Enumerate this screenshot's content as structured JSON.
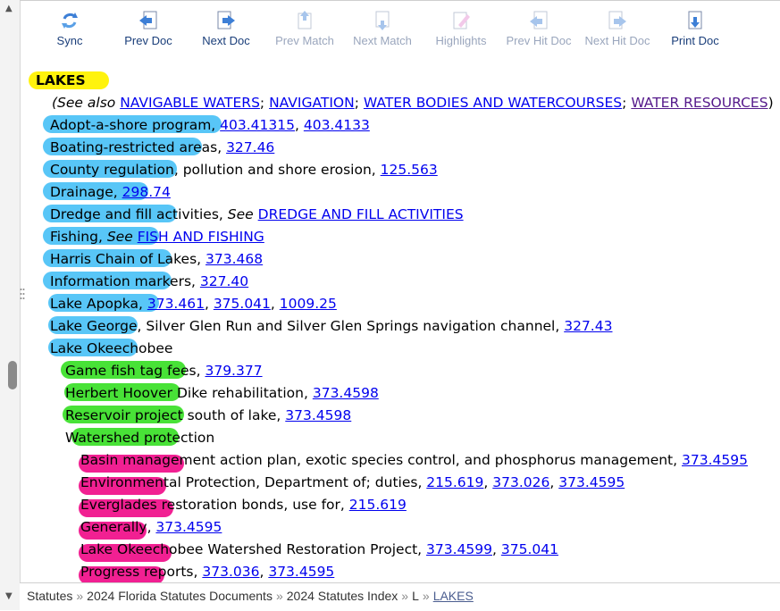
{
  "toolbar": {
    "sync": "Sync",
    "prev_doc": "Prev Doc",
    "next_doc": "Next Doc",
    "prev_match": "Prev Match",
    "next_match": "Next Match",
    "highlights": "Highlights",
    "prev_hit_doc": "Prev Hit Doc",
    "next_hit_doc": "Next Hit Doc",
    "print_doc": "Print Doc"
  },
  "index": {
    "heading": "LAKES",
    "see_also": {
      "prefix": "(See also",
      "links": [
        "NAVIGABLE WATERS",
        "NAVIGATION",
        "WATER BODIES AND WATERCOURSES",
        "WATER RESOURCES"
      ],
      "suffix": ")"
    },
    "entries": [
      {
        "text": "Adopt-a-shore program, ",
        "links": [
          "403.41315",
          "403.4133"
        ]
      },
      {
        "text": "Boating-restricted areas, ",
        "links": [
          "327.46"
        ]
      },
      {
        "text": "County regulation, pollution and shore erosion, ",
        "links": [
          "125.563"
        ]
      },
      {
        "text": "Drainage, ",
        "links": [
          "298.74"
        ]
      },
      {
        "text": "Dredge and fill activities, ",
        "see": "See",
        "links": [
          "DREDGE AND FILL ACTIVITIES"
        ]
      },
      {
        "text": "Fishing, ",
        "see": "See",
        "links": [
          "FISH AND FISHING"
        ]
      },
      {
        "text": "Harris Chain of Lakes, ",
        "links": [
          "373.468"
        ]
      },
      {
        "text": "Information markers, ",
        "links": [
          "327.40"
        ]
      },
      {
        "text": "Lake Apopka, ",
        "links": [
          "373.461",
          "375.041",
          "1009.25"
        ]
      },
      {
        "text": "Lake George, Silver Glen Run and Silver Glen Springs navigation channel, ",
        "links": [
          "327.43"
        ]
      },
      {
        "text": "Lake Okeechobee"
      }
    ],
    "okeechobee_sub": [
      {
        "text": "Game fish tag fees, ",
        "links": [
          "379.377"
        ]
      },
      {
        "text": "Herbert Hoover Dike rehabilitation, ",
        "links": [
          "373.4598"
        ]
      },
      {
        "text": "Reservoir project south of lake, ",
        "links": [
          "373.4598"
        ]
      },
      {
        "text": "Watershed protection"
      }
    ],
    "watershed_sub": [
      {
        "text": "Basin management action plan, exotic species control, and phosphorus management, ",
        "links": [
          "373.4595"
        ]
      },
      {
        "text": "Environmental Protection, Department of; duties, ",
        "links": [
          "215.619",
          "373.026",
          "373.4595"
        ]
      },
      {
        "text": "Everglades restoration bonds, use for, ",
        "links": [
          "215.619"
        ]
      },
      {
        "text": "Generally, ",
        "links": [
          "373.4595"
        ]
      },
      {
        "text": "Lake Okeechobee Watershed Restoration Project, ",
        "links": [
          "373.4599",
          "375.041"
        ]
      },
      {
        "text": "Progress reports, ",
        "links": [
          "373.036",
          "373.4595"
        ]
      }
    ]
  },
  "breadcrumb": {
    "items": [
      "Statutes",
      "2024 Florida Statutes Documents",
      "2024 Statutes Index",
      "L"
    ],
    "current": "LAKES",
    "separator": "»"
  },
  "colors": {
    "link": "#0000ee",
    "visited_link": "#551a8b",
    "highlight_yellow": "#fff200",
    "highlight_blue": "#4fc3f7",
    "highlight_green": "#3ee02c",
    "highlight_pink": "#f0148c"
  }
}
